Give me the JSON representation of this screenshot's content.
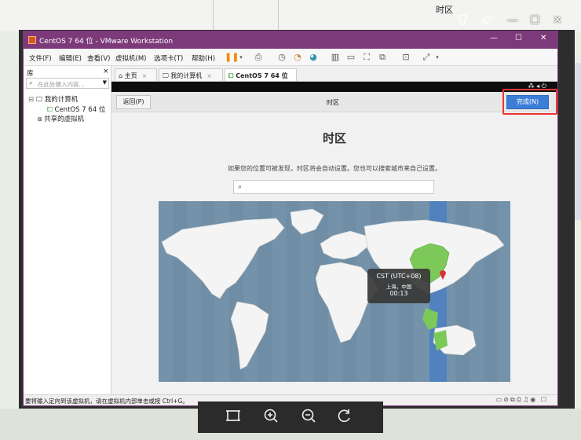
{
  "desktop": {
    "top_title": "时区"
  },
  "viewer_controls": {
    "shirt_icon": "shirt-icon",
    "pin_icon": "pin-icon",
    "minimize": "—",
    "maximize": "☐",
    "close": "✕"
  },
  "vmware": {
    "title": "CentOS 7 64 位 - VMware Workstation",
    "window_buttons": {
      "minimize": "—",
      "maximize": "☐",
      "close": "✕"
    },
    "menu": [
      "文件(F)",
      "编辑(E)",
      "查看(V)",
      "虚拟机(M)",
      "选项卡(T)",
      "帮助(H)"
    ],
    "library": {
      "label": "库",
      "close": "×",
      "search_placeholder": "在此处键入内容...",
      "tree": {
        "my_computer": "我的计算机",
        "vm_name": "CentOS 7 64 位",
        "shared": "共享的虚拟机"
      }
    },
    "tabs": [
      {
        "label": "主页",
        "icon": "home-icon"
      },
      {
        "label": "我的计算机",
        "icon": "monitor-icon"
      },
      {
        "label": "CentOS 7 64 位",
        "icon": "vm-icon"
      }
    ],
    "status_text": "要将输入定向到该虚拟机，请在虚拟机内部单击或按 Ctrl+G。"
  },
  "installer": {
    "back_label": "返回(P)",
    "header_title": "时区",
    "done_label": "完成(N)",
    "page_title": "时区",
    "hint": "如果您的位置可被发现，时区将会自动设置。您也可以搜索城市来自己设置。",
    "popup": {
      "zone": "CST (UTC+08)",
      "city": "上海，中国",
      "time": "00:13"
    },
    "highlight_color": "#ee3333",
    "selected_region_color": "#7cc95a"
  },
  "viewer_toolbar": {
    "fit_icon": "fit-screen-icon",
    "zoom_in_icon": "zoom-in-icon",
    "zoom_out_icon": "zoom-out-icon",
    "rotate_icon": "rotate-icon"
  }
}
